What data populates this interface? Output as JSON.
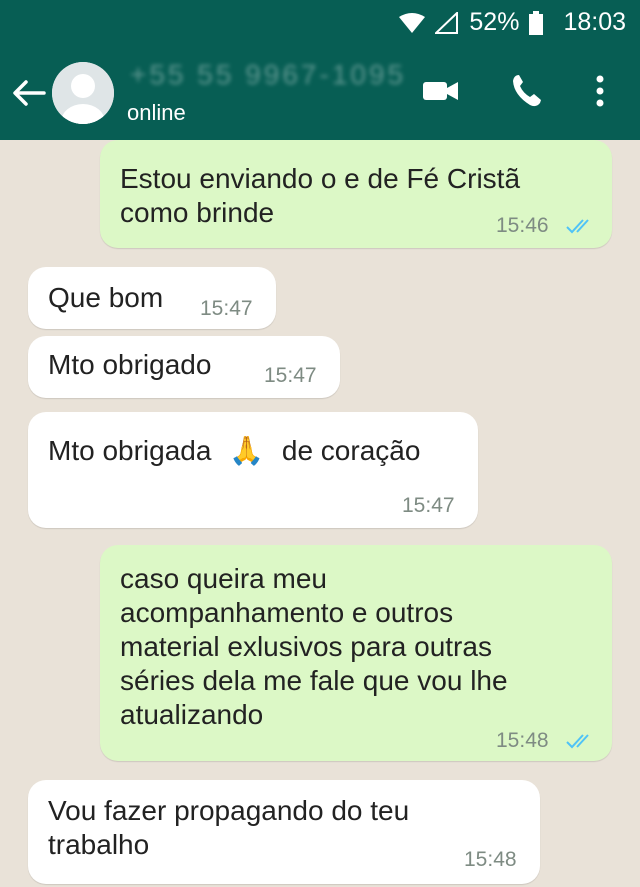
{
  "status_bar": {
    "battery": "52%",
    "time": "18:03",
    "icons": [
      "wifi-icon",
      "signal-icon",
      "battery-icon"
    ]
  },
  "header": {
    "contact_name": "+55 55 9967-1095",
    "status": "online",
    "icons": [
      "back-arrow-icon",
      "avatar-icon",
      "video-call-icon",
      "phone-icon",
      "more-options-icon"
    ]
  },
  "messages": [
    {
      "direction": "outgoing",
      "text_lines": [
        "Estou enviando o e de Fé Cristã",
        "como brinde"
      ],
      "time": "15:46",
      "read": true
    },
    {
      "direction": "incoming",
      "text": "Que bom",
      "time": "15:47"
    },
    {
      "direction": "incoming",
      "text": "Mto obrigado",
      "time": "15:47"
    },
    {
      "direction": "incoming",
      "text_before_emoji": "Mto obrigada",
      "emoji": "🙏",
      "text_after_emoji": "de coração",
      "time": "15:47"
    },
    {
      "direction": "outgoing",
      "text_lines": [
        "caso queira meu",
        "acompanhamento e outros",
        "material exlusivos para outras",
        "séries dela me fale que vou lhe",
        "atualizando"
      ],
      "time": "15:48",
      "read": true
    },
    {
      "direction": "incoming",
      "text_lines": [
        "Vou fazer propagando do teu",
        "trabalho"
      ],
      "time": "15:48"
    }
  ],
  "colors": {
    "header": "#075e54",
    "outgoing_bubble": "#dcf8c6",
    "incoming_bubble": "#ffffff",
    "chat_background": "#e9e2d8",
    "read_ticks": "#4fc3f7"
  }
}
